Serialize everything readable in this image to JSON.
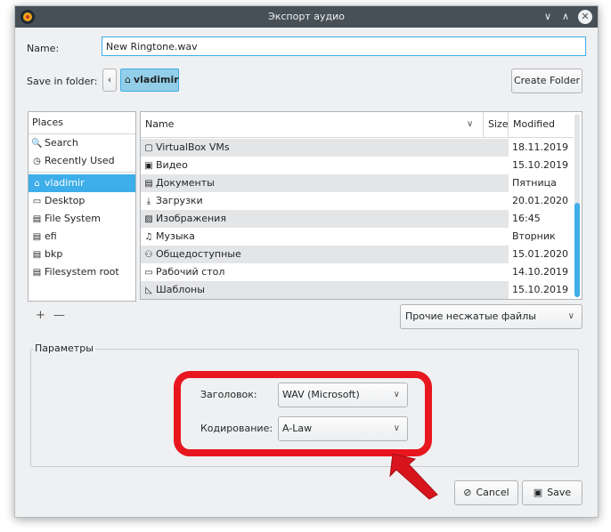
{
  "window": {
    "title": "Экспорт аудио",
    "icon": "audacity-icon"
  },
  "titlebar": {
    "minimize": "∨",
    "maximize": "∧",
    "close": "✕"
  },
  "name_field": {
    "label": "Name:",
    "value": "New Ringtone.wav"
  },
  "save_in": {
    "label": "Save in folder:",
    "back": "‹",
    "crumb": "vladimir",
    "create_folder": "Create Folder"
  },
  "places": {
    "header": "Places",
    "items": [
      {
        "label": "Search",
        "icon": "🔍",
        "selected": false
      },
      {
        "label": "Recently Used",
        "icon": "◷",
        "selected": false
      },
      {
        "label": "vladimir",
        "icon": "⌂",
        "selected": true
      },
      {
        "label": "Desktop",
        "icon": "▭",
        "selected": false
      },
      {
        "label": "File System",
        "icon": "▤",
        "selected": false
      },
      {
        "label": "efi",
        "icon": "▤",
        "selected": false
      },
      {
        "label": "bkp",
        "icon": "▤",
        "selected": false
      },
      {
        "label": "Filesystem root",
        "icon": "▤",
        "selected": false
      }
    ],
    "add": "+",
    "remove": "—"
  },
  "files": {
    "columns": {
      "name": "Name",
      "size": "Size",
      "modified": "Modified"
    },
    "rows": [
      {
        "icon": "▢",
        "name": "VirtualBox VMs",
        "size": "",
        "modified": "18.11.2019"
      },
      {
        "icon": "▣",
        "name": "Видео",
        "size": "",
        "modified": "15.10.2019"
      },
      {
        "icon": "▤",
        "name": "Документы",
        "size": "",
        "modified": "Пятница"
      },
      {
        "icon": "⤓",
        "name": "Загрузки",
        "size": "",
        "modified": "20.01.2020"
      },
      {
        "icon": "▨",
        "name": "Изображения",
        "size": "",
        "modified": "16:45"
      },
      {
        "icon": "♫",
        "name": "Музыка",
        "size": "",
        "modified": "Вторник"
      },
      {
        "icon": "⚇",
        "name": "Общедоступные",
        "size": "",
        "modified": "15.01.2020"
      },
      {
        "icon": "▭",
        "name": "Рабочий стол",
        "size": "",
        "modified": "14.10.2019"
      },
      {
        "icon": "◺",
        "name": "Шаблоны",
        "size": "",
        "modified": "15.10.2019"
      }
    ]
  },
  "filter": {
    "value": "Прочие несжатые файлы"
  },
  "params": {
    "title": "Параметры",
    "header_label": "Заголовок:",
    "header_value": "WAV (Microsoft)",
    "encoding_label": "Кодирование:",
    "encoding_value": "A-Law"
  },
  "actions": {
    "cancel": "Cancel",
    "save": "Save"
  },
  "colors": {
    "accent": "#3daee9",
    "highlight": "#e8171f",
    "titlebar": "#475057"
  }
}
